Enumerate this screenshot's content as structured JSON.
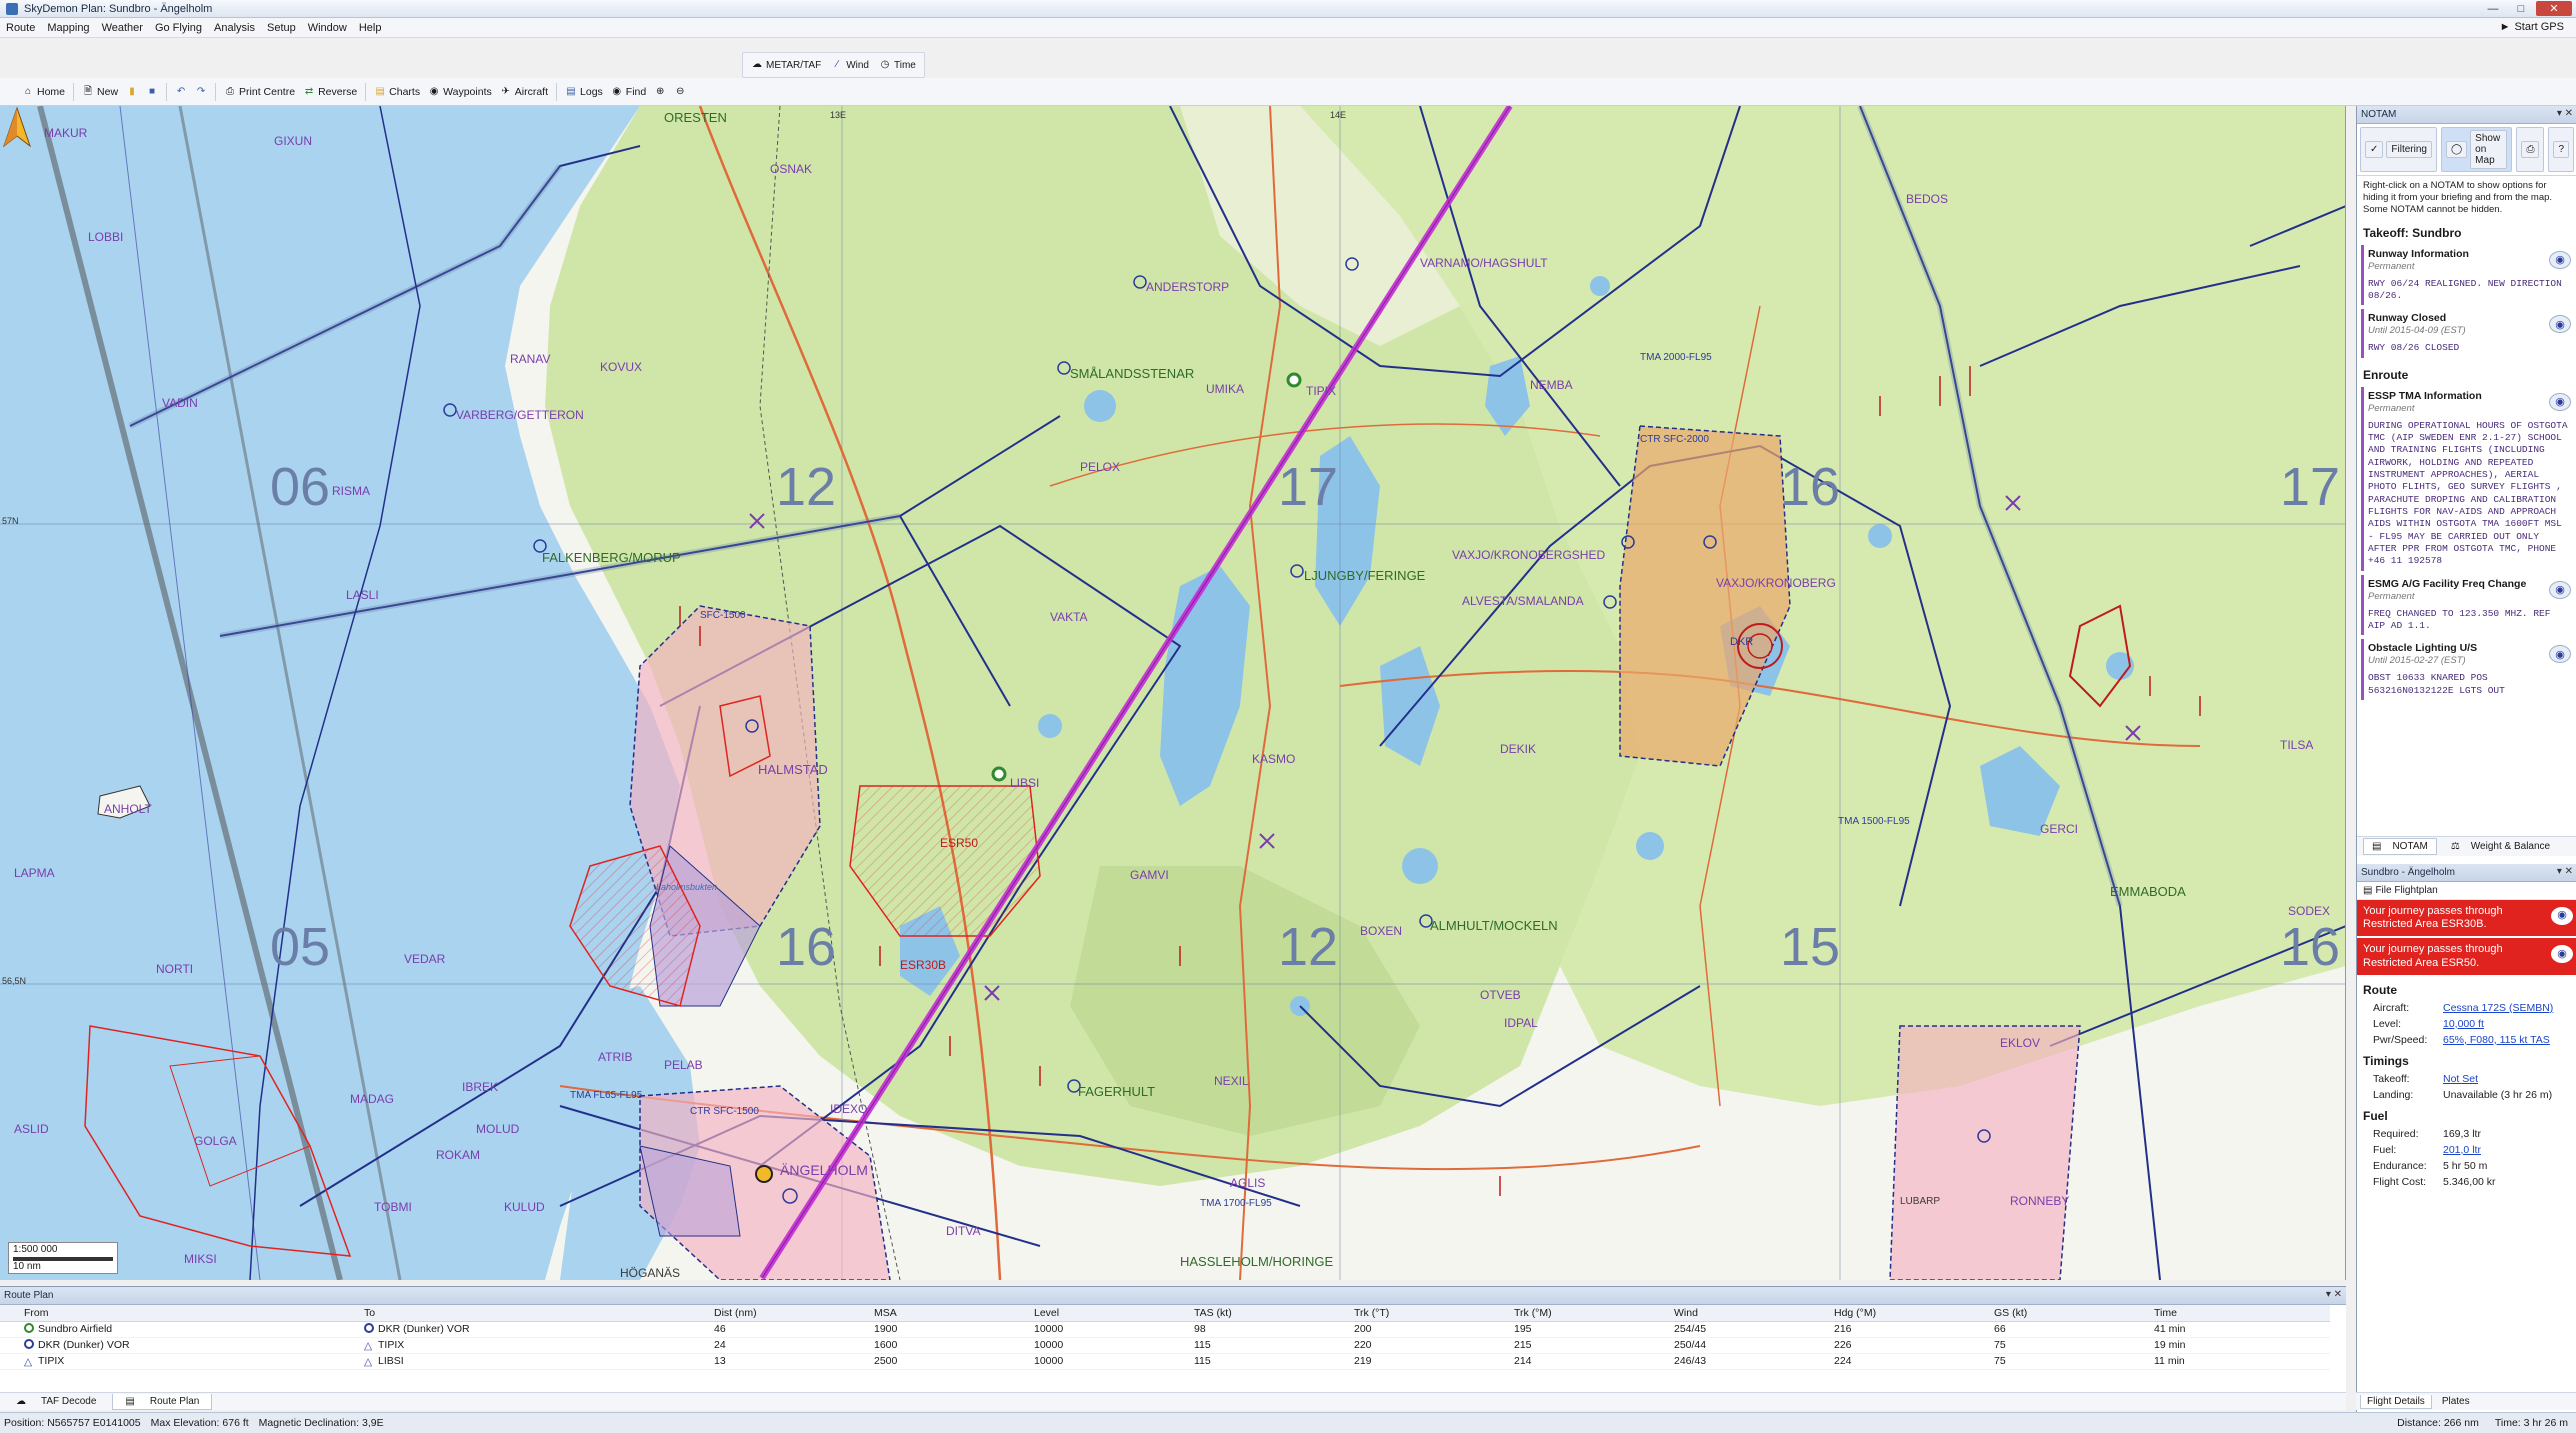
{
  "window": {
    "title": "SkyDemon Plan: Sundbro - Ängelholm"
  },
  "menu": [
    "Route",
    "Mapping",
    "Weather",
    "Go Flying",
    "Analysis",
    "Setup",
    "Window",
    "Help"
  ],
  "start_gps": "Start GPS",
  "toolbar_top": {
    "metar": "METAR/TAF",
    "wind": "Wind",
    "time": "Time"
  },
  "toolbar": {
    "home": "Home",
    "new": "New",
    "print": "Print Centre",
    "reverse": "Reverse",
    "charts": "Charts",
    "waypoints": "Waypoints",
    "aircraft": "Aircraft",
    "logs": "Logs",
    "find": "Find"
  },
  "map": {
    "grid": [
      "06",
      "05",
      "12",
      "17",
      "16",
      "17",
      "16",
      "15",
      "12",
      "16"
    ],
    "labels": {
      "varnamo": "VARNAMO/HAGSHULT",
      "anderstorp": "ANDERSTORP",
      "smalandsstenar": "SMÅLANDSSTENAR",
      "ljungby": "LJUNGBY/FERINGE",
      "vaxjo_ronneby": "VAXJO/KRONOBERGSHED",
      "vaxjo_kronoberg": "VAXJO/KRONOBERG",
      "alvesta": "ALVESTA/SMALANDA",
      "almhult": "ALMHULT/MOCKELN",
      "fagerhult": "FAGERHULT",
      "hassleholm": "HASSLEHOLM/HORINGE",
      "angelholm": "ÄNGELHOLM",
      "halmstad": "HALMSTAD",
      "falkenberg": "FALKENBERG/MORUP",
      "varberg": "VARBERG/GETTERON",
      "anholt": "ANHOLT",
      "emmaboda": "EMMABODA",
      "ronneby": "RONNEBY",
      "hoganas": "HÖGANÄS",
      "oresten": "ORESTEN"
    },
    "waypoints": [
      "MAKUR",
      "GIXUN",
      "LOBBI",
      "VADIN",
      "RANAV",
      "RISMA",
      "KOVUX",
      "LASLI",
      "NORTI",
      "VEDAR",
      "LAPMA",
      "MADAG",
      "GOLGA",
      "ASLID",
      "TOBMI",
      "MIKSI",
      "OSNAK",
      "PELOX",
      "VAKTA",
      "TIPIX",
      "UMIKA",
      "NEMBA",
      "DEKIK",
      "KASMO",
      "GAMVI",
      "OTVEB",
      "IDPAL",
      "NEXIL",
      "AGLIS",
      "BEDOS",
      "TILSA",
      "GERCI",
      "SODEX",
      "LIBSI",
      "DKR",
      "ESR50",
      "ESR30B",
      "ATRIB",
      "PELAB",
      "IBREK",
      "MOLUD",
      "ROKAM",
      "KULUD",
      "DITVA",
      "IDEXO",
      "BOXEN",
      "EKLOV",
      "LUBARP"
    ],
    "airspace": [
      "TMA 2000-FL95",
      "TMA 1500-FL95",
      "TMA 1700-FL95",
      "CTR SFC-2000",
      "CTR SFC-1500",
      "TMA FL65-FL95",
      "SFC-1500"
    ],
    "lat_57": "57N",
    "lat_565": "56,5N",
    "lon_13": "13E",
    "lon_14": "14E",
    "lake": "Laholmsbukten",
    "scale": {
      "ratio": "1:500 000",
      "unit": "10 nm"
    }
  },
  "notam": {
    "panel_title": "NOTAM",
    "filter": "Filtering",
    "show_map": "Show on Map",
    "tip": "Right-click on a NOTAM to show options for hiding it from your briefing and from the map. Some NOTAM cannot be hidden.",
    "takeoff_heading": "Takeoff: Sundbro",
    "takeoff_items": [
      {
        "title": "Runway Information",
        "status": "Permanent",
        "body": "RWY 06/24 REALIGNED. NEW DIRECTION 08/26."
      },
      {
        "title": "Runway Closed",
        "status": "Until 2015-04-09 (EST)",
        "body": "RWY 08/26 CLOSED"
      }
    ],
    "enroute_heading": "Enroute",
    "enroute_items": [
      {
        "title": "ESSP TMA Information",
        "status": "Permanent",
        "body": "DURING OPERATIONAL HOURS OF OSTGOTA TMC (AIP SWEDEN ENR 2.1-27) SCHOOL AND TRAINING FLIGHTS (INCLUDING AIRWORK, HOLDING AND REPEATED INSTRUMENT APPROACHES), AERIAL PHOTO FLIHTS, GEO SURVEY FLIGHTS , PARACHUTE DROPING AND CALIBRATION FLIGHTS FOR NAV-AIDS AND APPROACH AIDS WITHIN OSTGOTA TMA 1600FT MSL - FL95 MAY BE CARRIED OUT ONLY AFTER PPR FROM OSTGOTA TMC, PHONE +46 11 192578"
      },
      {
        "title": "ESMG A/G Facility Freq Change",
        "status": "Permanent",
        "body": "FREQ CHANGED TO 123.350 MHZ. REF AIP AD 1.1."
      },
      {
        "title": "Obstacle Lighting U/S",
        "status": "Until 2015-02-27 (EST)",
        "body": "OBST 10633 KNARED POS 563216N0132122E LGTS OUT"
      }
    ],
    "bottom_tabs": [
      "NOTAM",
      "Weight & Balance"
    ]
  },
  "route_panel": {
    "title": "Sundbro - Ängelholm",
    "file_flightplan": "File Flightplan",
    "warnings": [
      "Your journey passes through Restricted Area ESR30B.",
      "Your journey passes through Restricted Area ESR50."
    ],
    "route_heading": "Route",
    "aircraft_label": "Aircraft:",
    "aircraft_value": "Cessna 172S (SEMBN)",
    "level_label": "Level:",
    "level_value": "10,000 ft",
    "pwr_label": "Pwr/Speed:",
    "pwr_value": "65%, F080, 115 kt TAS",
    "timings_heading": "Timings",
    "takeoff_label": "Takeoff:",
    "takeoff_value": "Not Set",
    "landing_label": "Landing:",
    "landing_value": "Unavailable (3 hr 26 m)",
    "fuel_heading": "Fuel",
    "required_label": "Required:",
    "required_value": "169,3 ltr",
    "fuel_label": "Fuel:",
    "fuel_value": "201,0 ltr",
    "endurance_label": "Endurance:",
    "endurance_value": "5 hr 50 m",
    "cost_label": "Flight Cost:",
    "cost_value": "5.346,00 kr"
  },
  "route_plan": {
    "title": "Route Plan",
    "columns": [
      "From",
      "To",
      "Dist (nm)",
      "MSA",
      "Level",
      "TAS (kt)",
      "Trk (°T)",
      "Trk (°M)",
      "Wind",
      "Hdg (°M)",
      "GS (kt)",
      "Time"
    ],
    "rows": [
      [
        "Sundbro Airfield",
        "DKR (Dunker) VOR",
        "46",
        "1900",
        "10000",
        "98",
        "200",
        "195",
        "254/45",
        "216",
        "66",
        "41 min"
      ],
      [
        "DKR (Dunker) VOR",
        "TIPIX",
        "24",
        "1600",
        "10000",
        "115",
        "220",
        "215",
        "250/44",
        "226",
        "75",
        "19 min"
      ],
      [
        "TIPIX",
        "LIBSI",
        "13",
        "2500",
        "10000",
        "115",
        "219",
        "214",
        "246/43",
        "224",
        "75",
        "11 min"
      ]
    ]
  },
  "bottom_tabs": [
    "TAF Decode",
    "Route Plan"
  ],
  "side_foot_tabs": [
    "Flight Details",
    "Plates"
  ],
  "status": {
    "position": "Position: N565757 E0141005",
    "elevation": "Max Elevation: 676 ft",
    "declination": "Magnetic Declination: 3,9E",
    "distance": "Distance: 266 nm",
    "time": "Time: 3 hr 26 m"
  }
}
